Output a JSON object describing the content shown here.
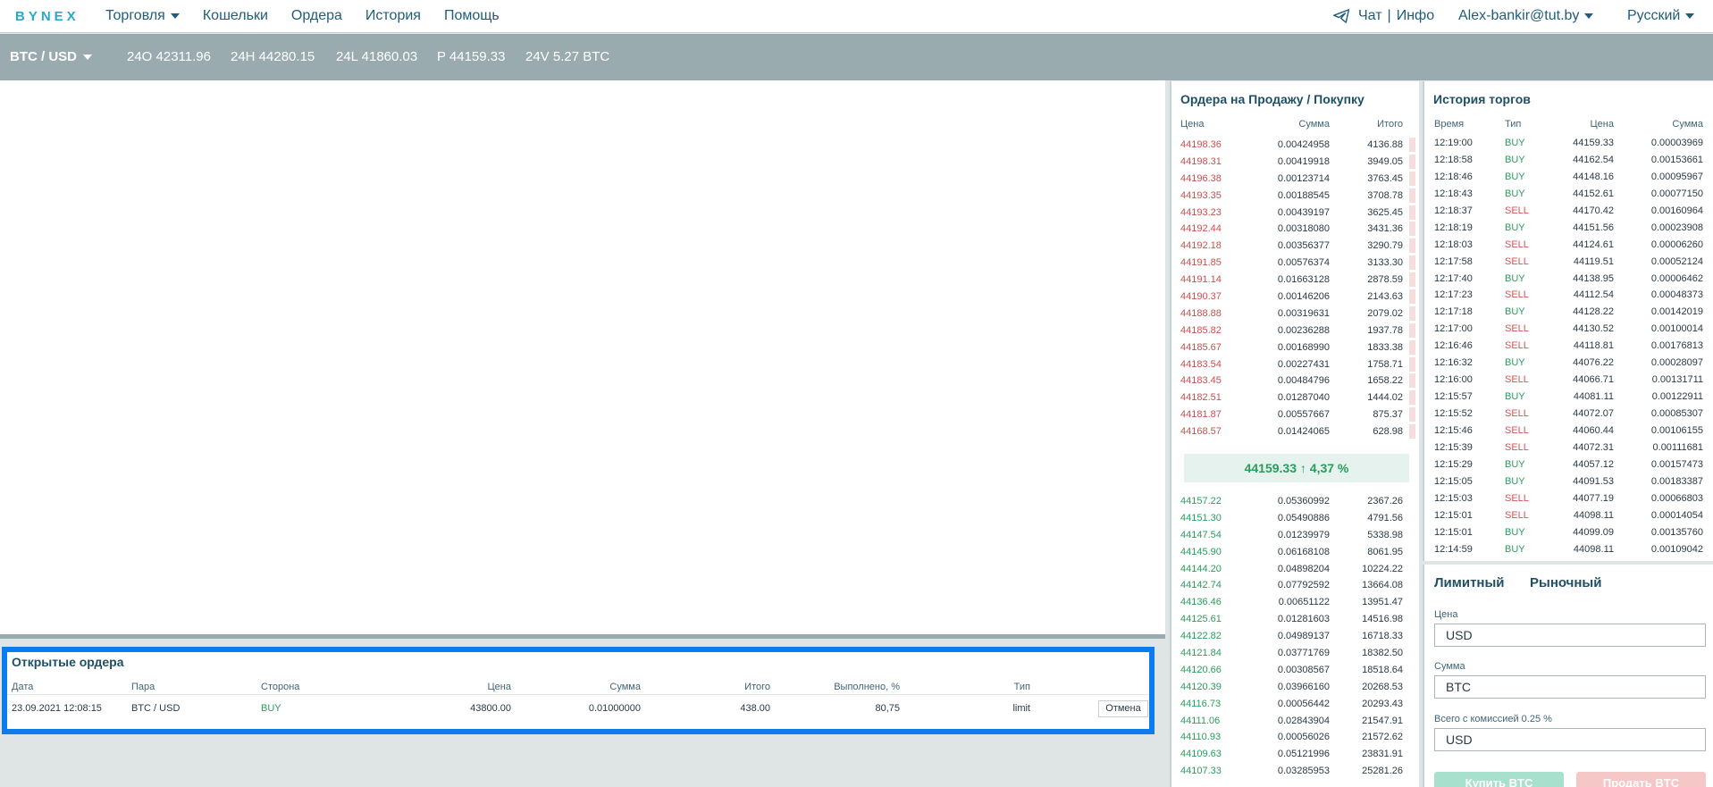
{
  "nav": {
    "logo": "BYNEX",
    "menu": [
      {
        "label": "Торговля",
        "has_caret": true
      },
      {
        "label": "Кошельки",
        "has_caret": false
      },
      {
        "label": "Ордера",
        "has_caret": false
      },
      {
        "label": "История",
        "has_caret": false
      },
      {
        "label": "Помощь",
        "has_caret": false
      }
    ],
    "chat": "Чат",
    "separator": "|",
    "info": "Инфо",
    "user": "Alex-bankir@tut.by",
    "language": "Русский"
  },
  "ticker": {
    "pair": "BTC / USD",
    "open": "24O 42311.96",
    "high": "24H 44280.15",
    "low": "24L 41860.03",
    "price": "P 44159.33",
    "volume": "24V 5.27 BTC"
  },
  "open_orders": {
    "title": "Открытые ордера",
    "headers": [
      "Дата",
      "Пара",
      "Сторона",
      "Цена",
      "Сумма",
      "Итого",
      "Выполнено, %",
      "Тип"
    ],
    "rows": [
      {
        "date": "23.09.2021 12:08:15",
        "pair": "BTC / USD",
        "side": "BUY",
        "price": "43800.00",
        "amount": "0.01000000",
        "total": "438.00",
        "filled": "80,75",
        "type": "limit",
        "cancel": "Отмена"
      }
    ]
  },
  "orderbook": {
    "title": "Ордера на Продажу / Покупку",
    "headers": {
      "price": "Цена",
      "amount": "Сумма",
      "total": "Итого"
    },
    "asks": [
      [
        "44198.36",
        "0.00424958",
        "4136.88"
      ],
      [
        "44198.31",
        "0.00419918",
        "3949.05"
      ],
      [
        "44196.38",
        "0.00123714",
        "3763.45"
      ],
      [
        "44193.35",
        "0.00188545",
        "3708.78"
      ],
      [
        "44193.23",
        "0.00439197",
        "3625.45"
      ],
      [
        "44192.44",
        "0.00318080",
        "3431.36"
      ],
      [
        "44192.18",
        "0.00356377",
        "3290.79"
      ],
      [
        "44191.85",
        "0.00576374",
        "3133.30"
      ],
      [
        "44191.14",
        "0.01663128",
        "2878.59"
      ],
      [
        "44190.37",
        "0.00146206",
        "2143.63"
      ],
      [
        "44188.88",
        "0.00319631",
        "2079.02"
      ],
      [
        "44185.82",
        "0.00236288",
        "1937.78"
      ],
      [
        "44185.67",
        "0.00168990",
        "1833.38"
      ],
      [
        "44183.54",
        "0.00227431",
        "1758.71"
      ],
      [
        "44183.45",
        "0.00484796",
        "1658.22"
      ],
      [
        "44182.51",
        "0.01287040",
        "1444.02"
      ],
      [
        "44181.87",
        "0.00557667",
        "875.37"
      ],
      [
        "44168.57",
        "0.01424065",
        "628.98"
      ]
    ],
    "mid_price": "44159.33 ↑ 4,37 %",
    "bids": [
      [
        "44157.22",
        "0.05360992",
        "2367.26"
      ],
      [
        "44151.30",
        "0.05490886",
        "4791.56"
      ],
      [
        "44147.54",
        "0.01239979",
        "5338.98"
      ],
      [
        "44145.90",
        "0.06168108",
        "8061.95"
      ],
      [
        "44144.20",
        "0.04898204",
        "10224.22"
      ],
      [
        "44142.74",
        "0.07792592",
        "13664.08"
      ],
      [
        "44136.46",
        "0.00651122",
        "13951.47"
      ],
      [
        "44125.61",
        "0.01281603",
        "14516.98"
      ],
      [
        "44122.82",
        "0.04989137",
        "16718.33"
      ],
      [
        "44121.84",
        "0.03771769",
        "18382.50"
      ],
      [
        "44120.66",
        "0.00308567",
        "18518.64"
      ],
      [
        "44120.39",
        "0.03966160",
        "20268.53"
      ],
      [
        "44116.73",
        "0.00056442",
        "20293.43"
      ],
      [
        "44111.06",
        "0.02843904",
        "21547.91"
      ],
      [
        "44110.93",
        "0.00056026",
        "21572.62"
      ],
      [
        "44109.63",
        "0.05121996",
        "23831.91"
      ],
      [
        "44107.33",
        "0.03285953",
        "25281.26"
      ]
    ]
  },
  "history": {
    "title": "История торгов",
    "headers": {
      "time": "Время",
      "type": "Тип",
      "price": "Цена",
      "amount": "Сумма"
    },
    "rows": [
      [
        "12:19:00",
        "BUY",
        "44159.33",
        "0.00003969"
      ],
      [
        "12:18:58",
        "BUY",
        "44162.54",
        "0.00153661"
      ],
      [
        "12:18:46",
        "BUY",
        "44148.16",
        "0.00095967"
      ],
      [
        "12:18:43",
        "BUY",
        "44152.61",
        "0.00077150"
      ],
      [
        "12:18:37",
        "SELL",
        "44170.42",
        "0.00160964"
      ],
      [
        "12:18:19",
        "BUY",
        "44151.56",
        "0.00023908"
      ],
      [
        "12:18:03",
        "SELL",
        "44124.61",
        "0.00006260"
      ],
      [
        "12:17:58",
        "SELL",
        "44119.51",
        "0.00052124"
      ],
      [
        "12:17:40",
        "BUY",
        "44138.95",
        "0.00006462"
      ],
      [
        "12:17:23",
        "SELL",
        "44112.54",
        "0.00048373"
      ],
      [
        "12:17:18",
        "BUY",
        "44128.22",
        "0.00142019"
      ],
      [
        "12:17:00",
        "SELL",
        "44130.52",
        "0.00100014"
      ],
      [
        "12:16:46",
        "SELL",
        "44118.81",
        "0.00176813"
      ],
      [
        "12:16:32",
        "BUY",
        "44076.22",
        "0.00028097"
      ],
      [
        "12:16:00",
        "SELL",
        "44066.71",
        "0.00131711"
      ],
      [
        "12:15:57",
        "BUY",
        "44081.11",
        "0.00122911"
      ],
      [
        "12:15:52",
        "SELL",
        "44072.07",
        "0.00085307"
      ],
      [
        "12:15:46",
        "SELL",
        "44060.44",
        "0.00106155"
      ],
      [
        "12:15:39",
        "SELL",
        "44072.31",
        "0.00111681"
      ],
      [
        "12:15:29",
        "BUY",
        "44057.12",
        "0.00157473"
      ],
      [
        "12:15:05",
        "BUY",
        "44091.53",
        "0.00183387"
      ],
      [
        "12:15:03",
        "SELL",
        "44077.19",
        "0.00066803"
      ],
      [
        "12:15:01",
        "SELL",
        "44098.11",
        "0.00014054"
      ],
      [
        "12:15:01",
        "BUY",
        "44099.09",
        "0.00135760"
      ],
      [
        "12:14:59",
        "BUY",
        "44098.11",
        "0.00109042"
      ]
    ]
  },
  "trade_form": {
    "tab_limit": "Лимитный",
    "tab_market": "Рыночный",
    "price_label": "Цена",
    "price_currency": "USD",
    "amount_label": "Сумма",
    "amount_currency": "BTC",
    "total_label": "Всего с комиссией 0.25 %",
    "total_currency": "USD",
    "buy_label": "Купить BTC",
    "sell_label": "Продать BTC"
  },
  "colors": {
    "accent": "#1f5d7a",
    "ticker_bg": "#9aabaf",
    "buy": "#2a9d5c",
    "sell": "#d45454",
    "highlight_border": "#0a7cf0"
  }
}
